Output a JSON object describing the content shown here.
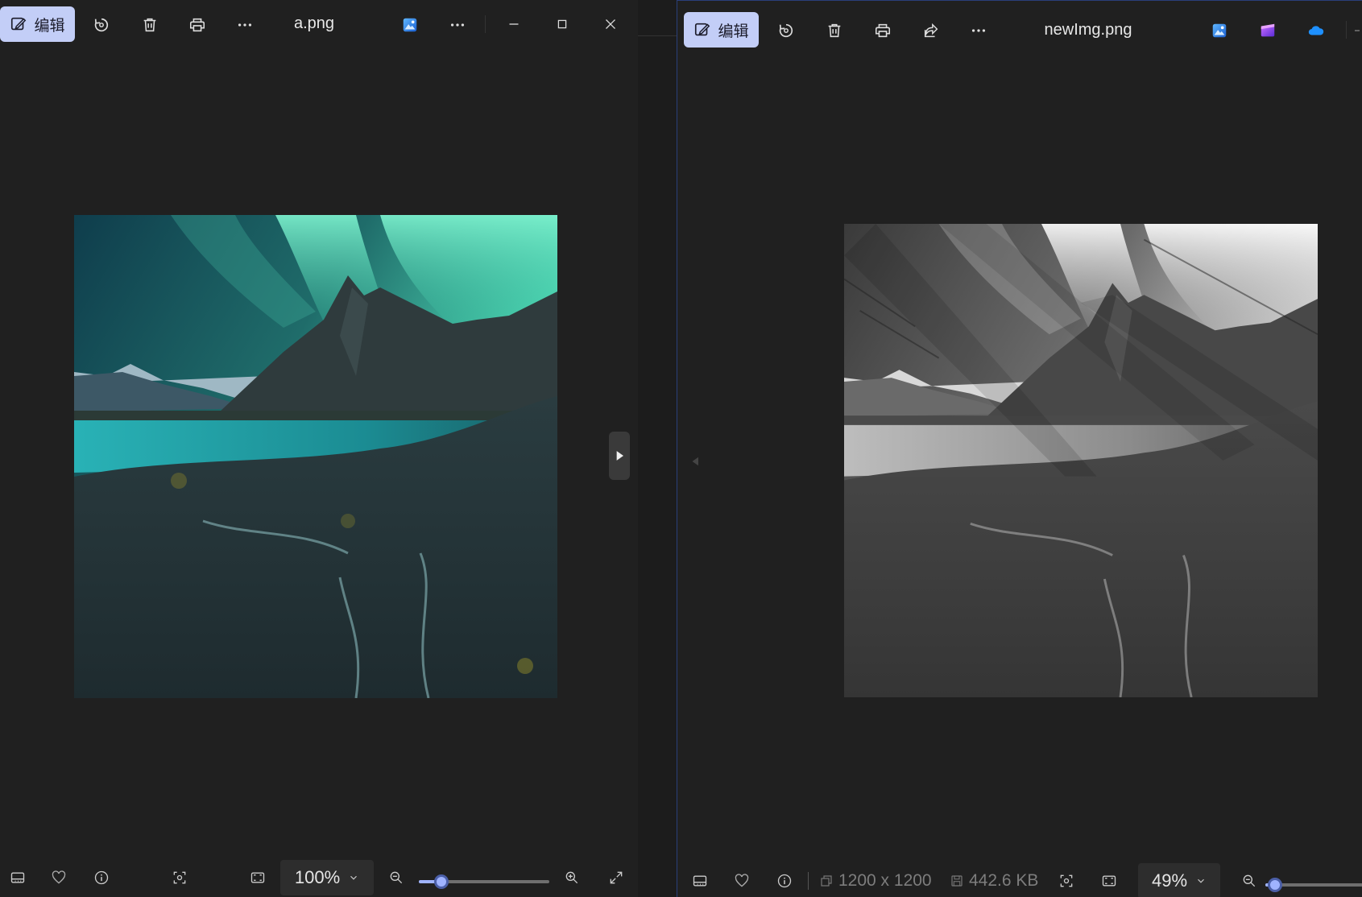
{
  "left_window": {
    "edit_label": "编辑",
    "filename": "a.png",
    "zoom": "100%",
    "zoom_level_fraction": 0.17,
    "icons": [
      "edit-icon",
      "rotate-icon",
      "trash-icon",
      "print-icon",
      "more-icon",
      "photos-app-icon",
      "more-icon",
      "minimize-icon",
      "maximize-icon",
      "close-icon",
      "filmstrip-icon",
      "heart-icon",
      "info-icon",
      "scan-icon",
      "fit-icon",
      "zoom-out-icon",
      "zoom-in-icon",
      "fullscreen-icon"
    ]
  },
  "right_window": {
    "edit_label": "编辑",
    "filename": "newImg.png",
    "dimensions": "1200 x 1200",
    "file_size": "442.6 KB",
    "zoom": "49%",
    "zoom_level_fraction": 0.1,
    "icons": [
      "edit-icon",
      "rotate-icon",
      "trash-icon",
      "print-icon",
      "share-icon",
      "more-icon",
      "photos-app-icon",
      "clipchamp-icon",
      "onedrive-icon",
      "filmstrip-icon",
      "heart-icon",
      "info-icon",
      "dimensions-icon",
      "disk-icon",
      "scan-icon",
      "fit-icon",
      "zoom-out-icon"
    ]
  },
  "colors": {
    "accent": "#c3cef7",
    "slider": "#9fb3ff",
    "background": "#202020"
  }
}
